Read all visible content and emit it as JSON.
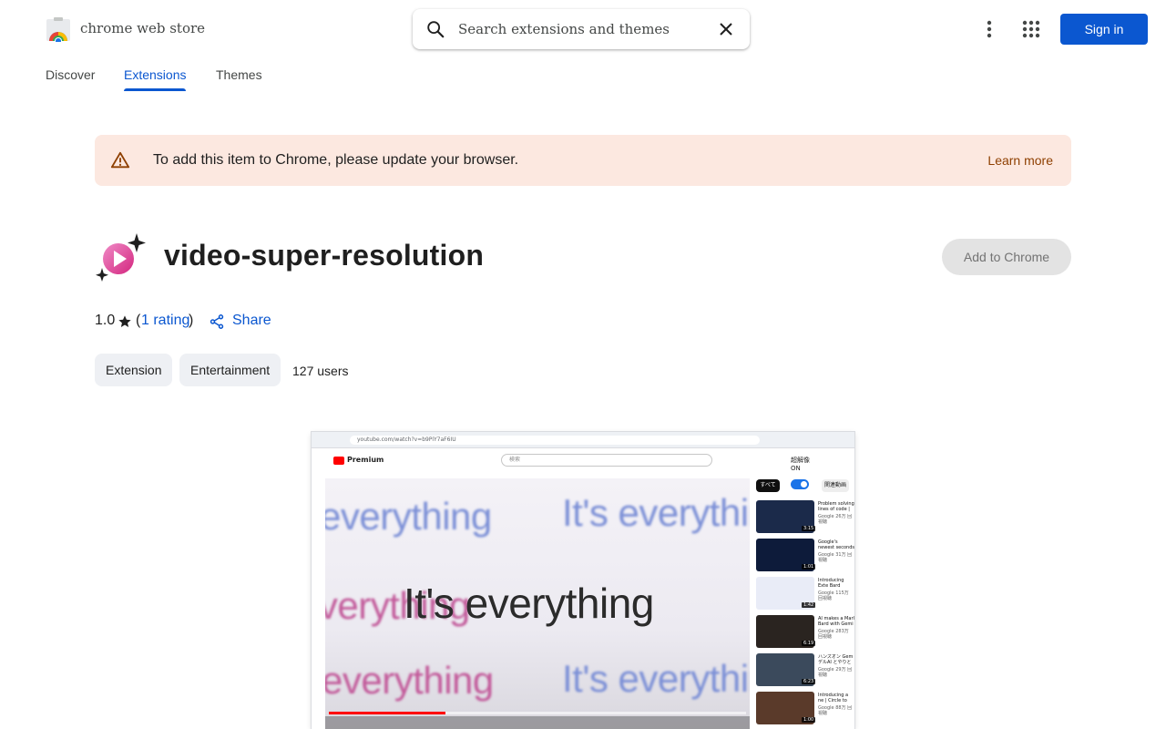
{
  "header": {
    "brand": "chrome web store",
    "search_placeholder": "Search extensions and themes",
    "sign_in": "Sign in"
  },
  "nav": {
    "tabs": [
      {
        "label": "Discover",
        "active": false
      },
      {
        "label": "Extensions",
        "active": true
      },
      {
        "label": "Themes",
        "active": false
      }
    ]
  },
  "banner": {
    "message": "To add this item to Chrome, please update your browser.",
    "link": "Learn more"
  },
  "item": {
    "title": "video-super-resolution",
    "add_button": "Add to Chrome",
    "rating_value": "1.0",
    "rating_count": "1 rating",
    "share": "Share",
    "chips": [
      "Extension",
      "Entertainment"
    ],
    "users": "127 users"
  },
  "preview": {
    "url": "youtube.com/watch?v=b9PiY7aF6IU",
    "yt_brand": "Premium",
    "yt_search": "検索",
    "panel_title": "超解像",
    "panel_state": "ON",
    "chip_all": "すべて",
    "chip_related": "関連動画",
    "video_phrase": "It's everything",
    "video_word": "everything",
    "side_videos": [
      {
        "title": "Problem solving lines of code | G",
        "meta": "Google 26万 回視聴",
        "duration": "3:15",
        "color": "#1b2a4a"
      },
      {
        "title": "Google's newest seconds | Gemi",
        "meta": "Google 31万 回視聴",
        "duration": "1:01",
        "color": "#0d1b3a"
      },
      {
        "title": "Introducing Exte Bard",
        "meta": "Google 115万 回視聴",
        "duration": "1:42",
        "color": "#e9ecf7"
      },
      {
        "title": "AI makes a Marl Bard with Gemi",
        "meta": "Google 283万 回視聴",
        "duration": "6:19",
        "color": "#2a2420"
      },
      {
        "title": "ハンズオン Gem デルAI とやりと",
        "meta": "Google 29万 回視聴",
        "duration": "6:23",
        "color": "#3b4a5c"
      },
      {
        "title": "Introducing a ne | Circle to Searc",
        "meta": "Google 88万 回視聴",
        "duration": "1:00",
        "color": "#5a3a2a"
      }
    ]
  },
  "colors": {
    "accent": "#0b57d0",
    "banner_bg": "#fce8e0",
    "banner_link": "#8e3f00",
    "chip_bg": "#eef0f4"
  }
}
